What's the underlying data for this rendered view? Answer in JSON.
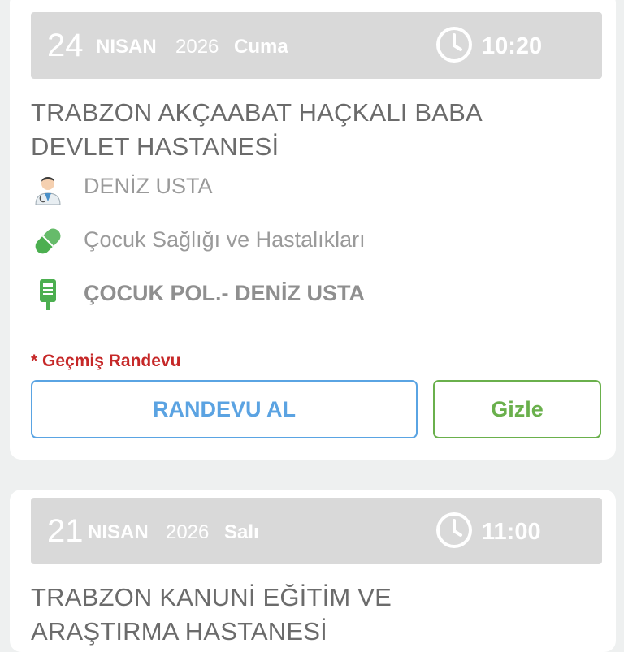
{
  "appointments": [
    {
      "day": "24",
      "month": "NISAN",
      "year": "2026",
      "weekday": "Cuma",
      "time": "10:20",
      "hospital_line1": "TRABZON AKÇAABAT HAÇKALI BABA",
      "hospital_line2": "DEVLET HASTANESİ",
      "doctor": "DENİZ USTA",
      "department": "Çocuk Sağlığı ve Hastalıkları",
      "clinic": "ÇOCUK POL.- DENİZ USTA",
      "note": "* Geçmiş Randevu",
      "primary_button": "RANDEVU AL",
      "hide_button": "Gizle"
    },
    {
      "day": "21",
      "month": "NISAN",
      "year": "2026",
      "weekday": "Salı",
      "time": "11:00",
      "hospital_line1": "TRABZON KANUNİ EĞİTİM VE",
      "hospital_line2": "ARAŞTIRMA HASTANESİ"
    }
  ],
  "colors": {
    "date_bar": "#d9d9d9",
    "primary": "#5ba3e2",
    "hide": "#6ab04c",
    "warning": "#c62828",
    "icon_green": "#4caf50"
  },
  "icons": [
    "clock-icon",
    "doctor-icon",
    "pill-icon",
    "clinic-icon"
  ]
}
